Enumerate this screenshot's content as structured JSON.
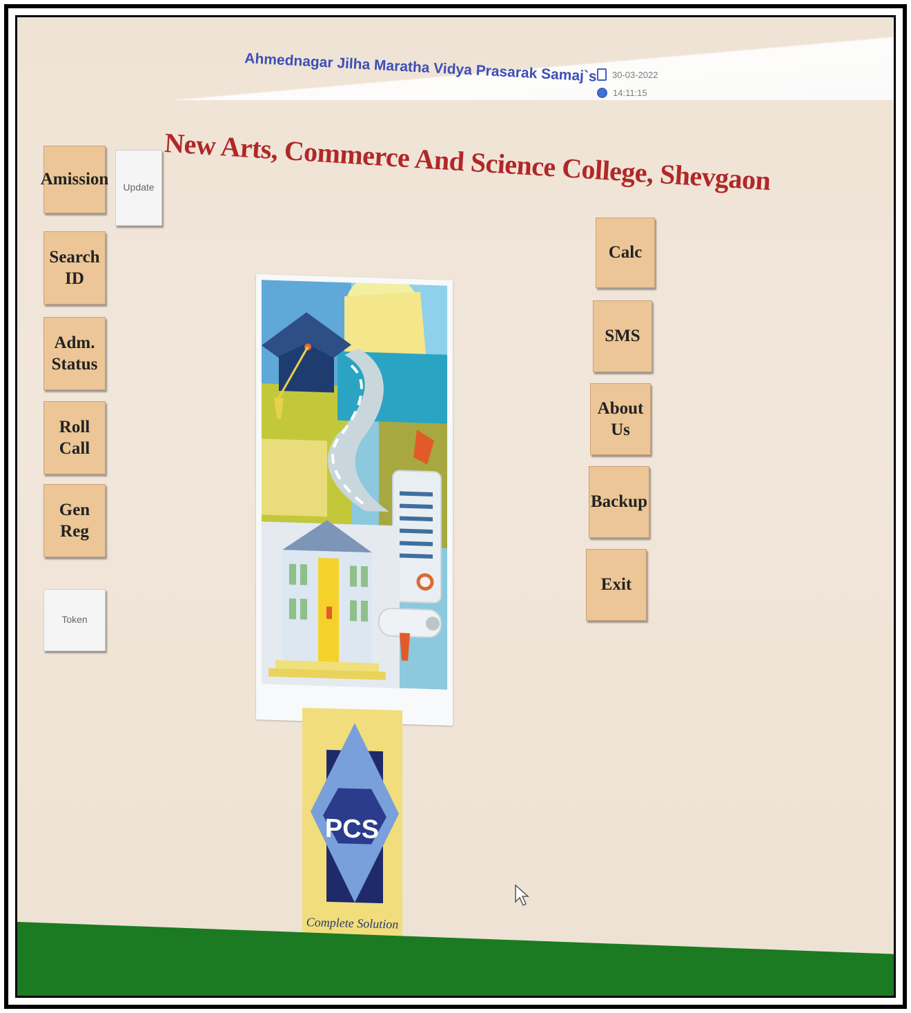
{
  "header": {
    "organization": "Ahmednagar Jilha Maratha Vidya Prasarak Samaj`s",
    "college_name": "New Arts, Commerce And Science College, Shevgaon",
    "date": "30-03-2022",
    "time": "14:11:15"
  },
  "left_buttons": {
    "admission": "Amission",
    "update": "Update",
    "search_id": "Search ID",
    "adm_status_line1": "Adm.",
    "adm_status_line2": "Status",
    "roll_call": "Roll Call",
    "gen_reg": "Gen Reg",
    "token": "Token"
  },
  "right_buttons": {
    "calc": "Calc",
    "sms": "SMS",
    "about_us": "About Us",
    "backup": "Backup",
    "exit": "Exit"
  },
  "logo": {
    "brand": "PCS",
    "tagline": "Complete Solution"
  },
  "colors": {
    "background": "#efe3d5",
    "button": "#ecc697",
    "title_red": "#b02828",
    "org_blue": "#3b4fb8",
    "footer_green": "#1c7a22",
    "logo_yellow": "#f1dd7c"
  },
  "icons": [
    "calendar-icon",
    "clock-icon",
    "mouse-pointer-icon",
    "education-clipart-image",
    "pcs-logo"
  ]
}
